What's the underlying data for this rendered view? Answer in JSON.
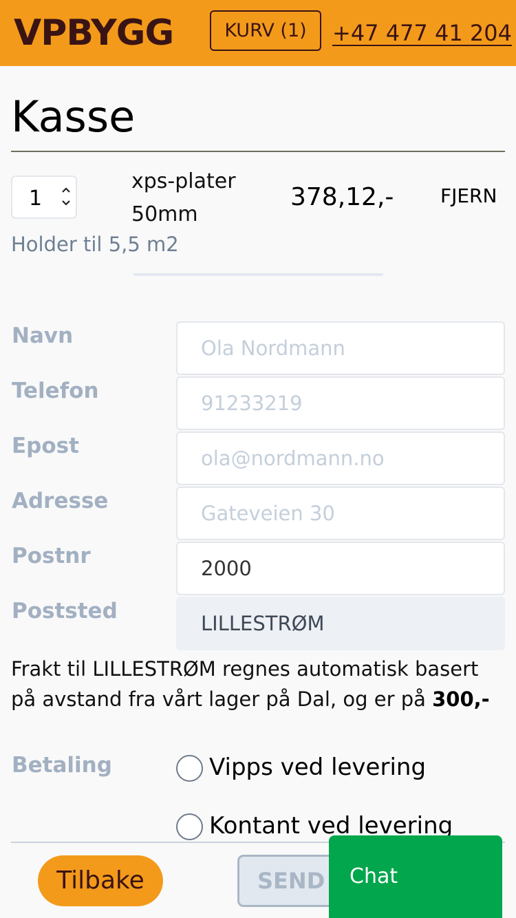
{
  "header": {
    "logo": "VPBYGG",
    "cart_label": "KURV (1)",
    "phone": "+47 477 41 204",
    "colors": {
      "background": "#f39a1b",
      "text": "#3a1414"
    }
  },
  "page": {
    "title": "Kasse"
  },
  "cart_item": {
    "quantity": "1",
    "name": "xps-plater 50mm",
    "price": "378,12,-",
    "remove_label": "FJERN",
    "note": "Holder til 5,5 m2"
  },
  "form": {
    "name": {
      "label": "Navn",
      "value": "",
      "placeholder": "Ola Nordmann"
    },
    "phone": {
      "label": "Telefon",
      "value": "",
      "placeholder": "91233219"
    },
    "email": {
      "label": "Epost",
      "value": "",
      "placeholder": "ola@nordmann.no"
    },
    "address": {
      "label": "Adresse",
      "value": "",
      "placeholder": "Gateveien 30"
    },
    "postnr": {
      "label": "Postnr",
      "value": "2000",
      "placeholder": ""
    },
    "poststed": {
      "label": "Poststed",
      "value": "LILLESTRØM"
    }
  },
  "freight": {
    "text": "Frakt til LILLESTRØM regnes automatisk basert på avstand fra vårt lager på Dal, og er på ",
    "amount": "300,-"
  },
  "payment": {
    "label": "Betaling",
    "options": [
      {
        "label": "Vipps ved levering",
        "selected": false
      },
      {
        "label": "Kontant ved levering",
        "selected": false
      }
    ]
  },
  "actions": {
    "back_label": "Tilbake",
    "send_label": "SEND"
  },
  "chat": {
    "label": "Chat",
    "color": "#02a64c"
  }
}
